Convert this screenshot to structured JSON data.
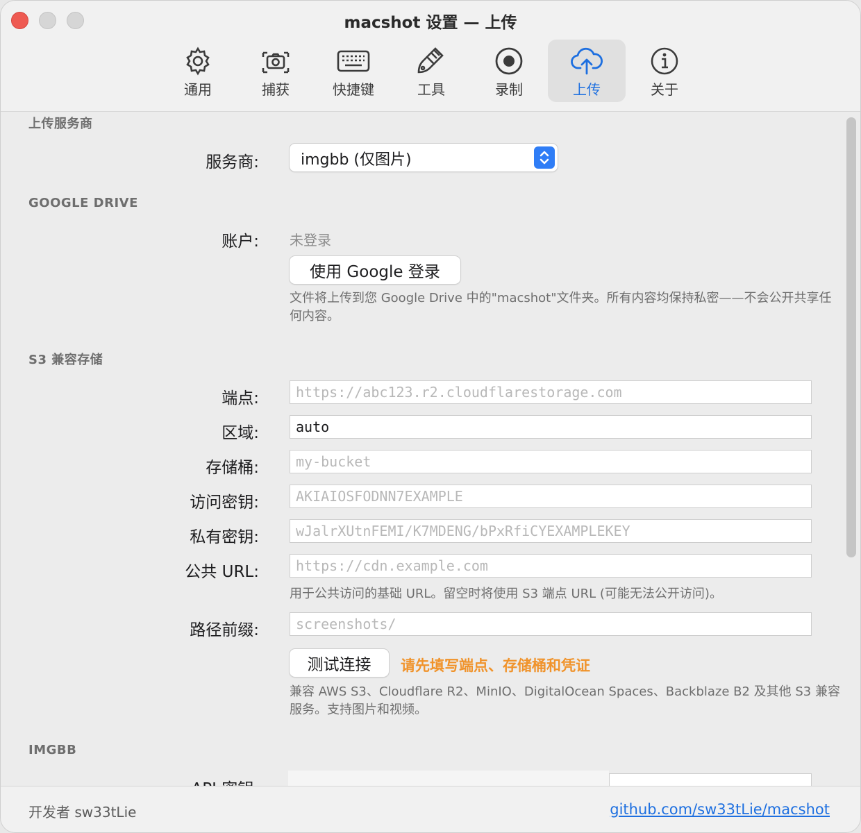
{
  "window": {
    "title": "macshot 设置 — 上传"
  },
  "tabs": [
    {
      "label": "通用",
      "icon": "gear-icon",
      "active": false
    },
    {
      "label": "捕获",
      "icon": "camera-icon",
      "active": false
    },
    {
      "label": "快捷键",
      "icon": "keyboard-icon",
      "active": false
    },
    {
      "label": "工具",
      "icon": "brush-icon",
      "active": false
    },
    {
      "label": "录制",
      "icon": "record-icon",
      "active": false
    },
    {
      "label": "上传",
      "icon": "cloud-upload-icon",
      "active": true
    },
    {
      "label": "关于",
      "icon": "info-icon",
      "active": false
    }
  ],
  "upload_provider": {
    "section": "上传服务商",
    "label": "服务商:",
    "value": "imgbb (仅图片)"
  },
  "google_drive": {
    "section": "GOOGLE DRIVE",
    "account_label": "账户:",
    "account_value": "未登录",
    "signin_button": "使用 Google 登录",
    "help": "文件将上传到您 Google Drive 中的\"macshot\"文件夹。所有内容均保持私密——不会公开共享任何内容。"
  },
  "s3": {
    "section": "S3 兼容存储",
    "fields": [
      {
        "label": "端点:",
        "value": "",
        "placeholder": "https://abc123.r2.cloudflarestorage.com"
      },
      {
        "label": "区域:",
        "value": "auto",
        "placeholder": ""
      },
      {
        "label": "存储桶:",
        "value": "",
        "placeholder": "my-bucket"
      },
      {
        "label": "访问密钥:",
        "value": "",
        "placeholder": "AKIAIOSFODNN7EXAMPLE"
      },
      {
        "label": "私有密钥:",
        "value": "",
        "placeholder": "wJalrXUtnFEMI/K7MDENG/bPxRfiCYEXAMPLEKEY"
      },
      {
        "label": "公共 URL:",
        "value": "",
        "placeholder": "https://cdn.example.com"
      }
    ],
    "public_url_help": "用于公共访问的基础 URL。留空时将使用 S3 端点 URL (可能无法公开访问)。",
    "prefix_label": "路径前缀:",
    "prefix_placeholder": "screenshots/",
    "test_button": "测试连接",
    "warning": "请先填写端点、存储桶和凭证",
    "help": "兼容 AWS S3、Cloudflare R2、MinIO、DigitalOcean Spaces、Backblaze B2 及其他 S3 兼容服务。支持图片和视频。"
  },
  "imgbb": {
    "section": "IMGBB",
    "api_label": "API 密钥:"
  },
  "footer": {
    "developer": "开发者 sw33tLie",
    "link": "github.com/sw33tLie/macshot"
  },
  "colors": {
    "accent": "#1d6fe0",
    "warning": "#f0932b",
    "close": "#ee5a52"
  }
}
